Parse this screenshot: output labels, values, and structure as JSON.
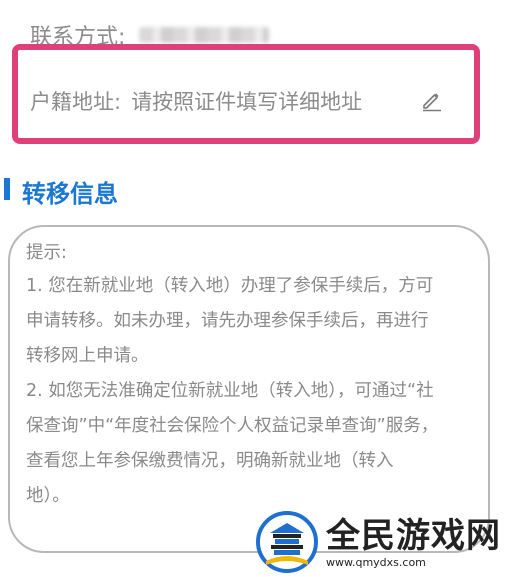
{
  "contact": {
    "label": "联系方式:"
  },
  "address": {
    "label": "户籍地址:",
    "placeholder": "请按照证件填写详细地址",
    "highlight_color": "#e0407a"
  },
  "section": {
    "title": "转移信息",
    "accent_color": "#1a77d2"
  },
  "tip": {
    "heading": "提示:",
    "lines": [
      "1. 您在新就业地（转入地）办理了参保手续后，方可",
      "申请转移。如未办理，请先办理参保手续后，再进行",
      "转移网上申请。",
      "2. 如您无法准确定位新就业地（转入地），可通过“社",
      "保查询”中“年度社会保险个人权益记录单查询”服务，",
      "查看您上年参保缴费情况，明确新就业地（转入",
      "地）。"
    ]
  },
  "watermark": {
    "title": "全民游戏网",
    "url": "www.qmydxs.com"
  },
  "icons": {
    "edit": "pencil-edit-icon",
    "logo": "temple-logo-icon"
  }
}
